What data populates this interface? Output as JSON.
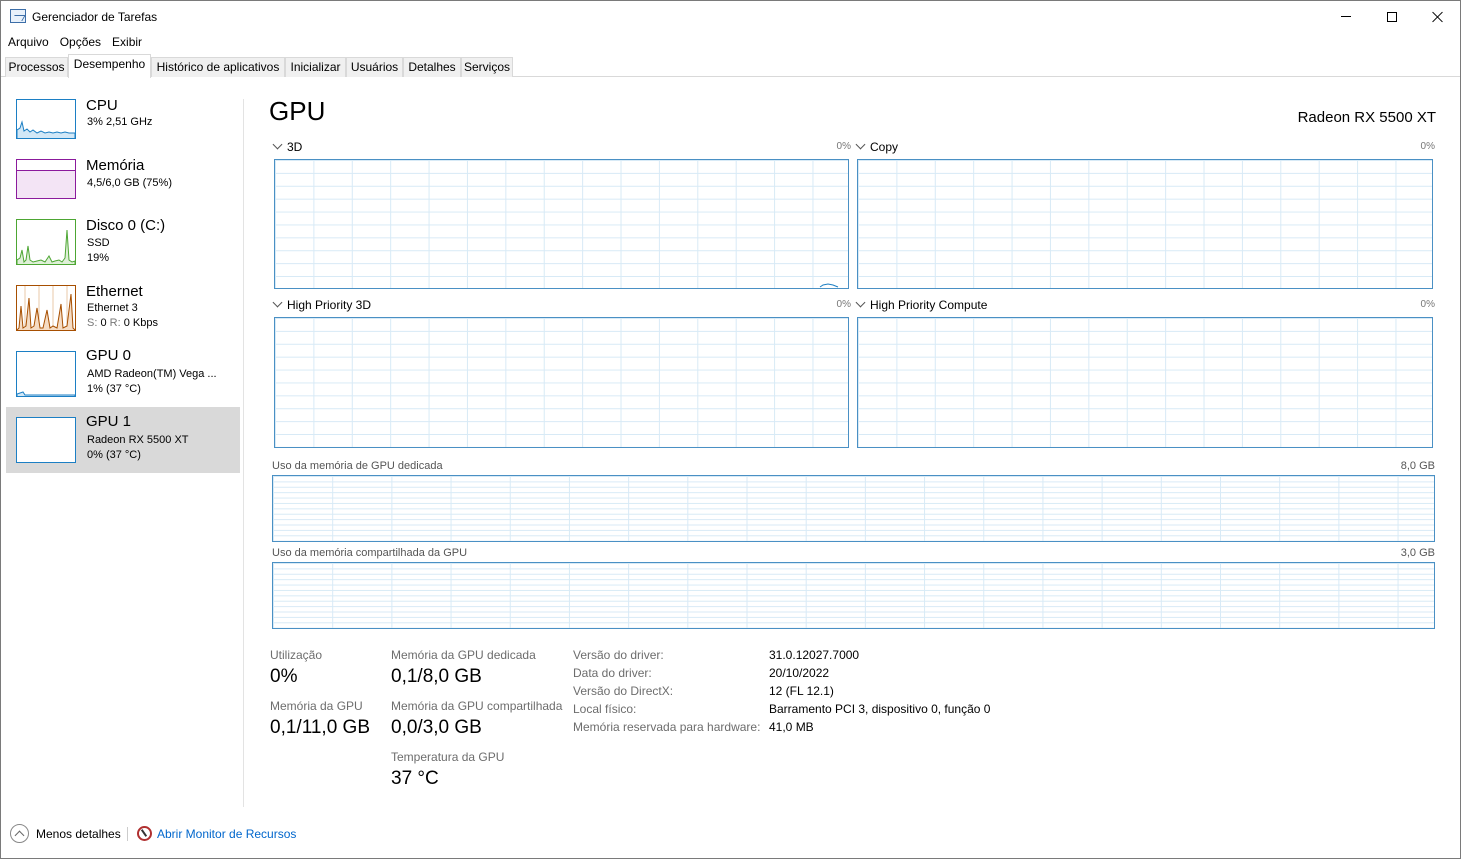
{
  "window": {
    "title": "Gerenciador de Tarefas"
  },
  "menu": [
    "Arquivo",
    "Opções",
    "Exibir"
  ],
  "tabs": [
    {
      "label": "Processos"
    },
    {
      "label": "Desempenho",
      "active": true
    },
    {
      "label": "Histórico de aplicativos"
    },
    {
      "label": "Inicializar"
    },
    {
      "label": "Usuários"
    },
    {
      "label": "Detalhes"
    },
    {
      "label": "Serviços"
    }
  ],
  "sidebar": {
    "items": [
      {
        "title": "CPU",
        "sub1": "3% 2,51 GHz",
        "sub2": "",
        "color": "#1c7fc4",
        "icon": "cpu-graph"
      },
      {
        "title": "Memória",
        "sub1": "4,5/6,0 GB (75%)",
        "sub2": "",
        "color": "#8b1a9c",
        "icon": "memory-graph"
      },
      {
        "title": "Disco 0 (C:)",
        "sub1": "SSD",
        "sub2": "19%",
        "color": "#4da633",
        "icon": "disk-graph"
      },
      {
        "title": "Ethernet",
        "sub1": "Ethernet 3",
        "sub2_s_label": "S:",
        "sub2_s": "0",
        "sub2_r_label": "R:",
        "sub2_r": "0 Kbps",
        "color": "#a74f01",
        "icon": "ethernet-graph"
      },
      {
        "title": "GPU 0",
        "sub1": "AMD Radeon(TM) Vega ...",
        "sub2": "1% (37 °C)",
        "color": "#1c7fc4",
        "icon": "gpu0-graph"
      },
      {
        "title": "GPU 1",
        "sub1": "Radeon RX 5500 XT",
        "sub2": "0% (37 °C)",
        "color": "#1c7fc4",
        "icon": "gpu1-graph",
        "selected": true
      }
    ]
  },
  "main": {
    "title": "GPU",
    "model": "Radeon RX 5500 XT",
    "engines": [
      {
        "label": "3D",
        "pct": "0%"
      },
      {
        "label": "Copy",
        "pct": "0%"
      },
      {
        "label": "High Priority 3D",
        "pct": "0%"
      },
      {
        "label": "High Priority Compute",
        "pct": "0%"
      }
    ],
    "dedicated_mem": {
      "label": "Uso da memória de GPU dedicada",
      "max": "8,0 GB"
    },
    "shared_mem": {
      "label": "Uso da memória compartilhada da GPU",
      "max": "3,0 GB"
    }
  },
  "stats": {
    "utilization": {
      "label": "Utilização",
      "value": "0%"
    },
    "gpu_memory": {
      "label": "Memória da GPU",
      "value": "0,1/11,0 GB"
    },
    "dedicated": {
      "label": "Memória da GPU dedicada",
      "value": "0,1/8,0 GB"
    },
    "shared": {
      "label": "Memória da GPU compartilhada",
      "value": "0,0/3,0 GB"
    },
    "temperature": {
      "label": "Temperatura da GPU",
      "value": "37 °C"
    }
  },
  "info": [
    {
      "key": "Versão do driver:",
      "value": "31.0.12027.7000"
    },
    {
      "key": "Data do driver:",
      "value": "20/10/2022"
    },
    {
      "key": "Versão do DirectX:",
      "value": "12 (FL 12.1)"
    },
    {
      "key": "Local físico:",
      "value": "Barramento PCI 3, dispositivo 0, função 0"
    },
    {
      "key": "Memória reservada para hardware:",
      "value": "41,0 MB"
    }
  ],
  "footer": {
    "less_details": "Menos detalhes",
    "open_monitor": "Abrir Monitor de Recursos"
  }
}
